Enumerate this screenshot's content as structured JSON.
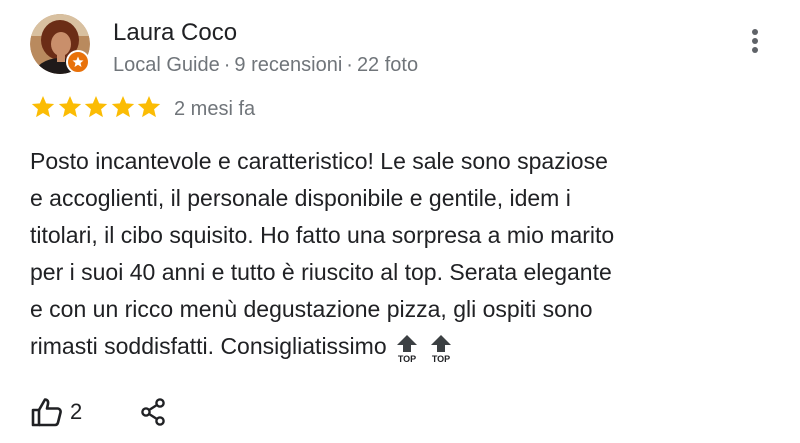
{
  "author": {
    "name": "Laura Coco",
    "badge": "Local Guide",
    "reviews": "9 recensioni",
    "photos": "22 foto",
    "separator": "·"
  },
  "review": {
    "rating": 5,
    "max_rating": 5,
    "date": "2 mesi fa",
    "lines": [
      "Posto incantevole e caratteristico! Le sale sono spaziose",
      "e accoglienti, il personale disponibile e gentile, idem i",
      "titolari, il cibo squisito. Ho fatto una sorpresa a mio marito",
      "per i suoi 40 anni e tutto è riuscito al top. Serata elegante",
      "e con un ricco menù degustazione pizza, gli ospiti sono",
      "rimasti soddisfatti. Consigliatissimo"
    ],
    "emoji_label": "TOP",
    "emoji_count": 2
  },
  "actions": {
    "like_count": "2",
    "like_icon": "thumbs-up-icon",
    "share_icon": "share-icon",
    "menu_icon": "more-vert-icon"
  },
  "colors": {
    "star": "#fbbc04",
    "badge": "#e8710a",
    "meta_text": "#70757a",
    "primary_text": "#202124"
  }
}
